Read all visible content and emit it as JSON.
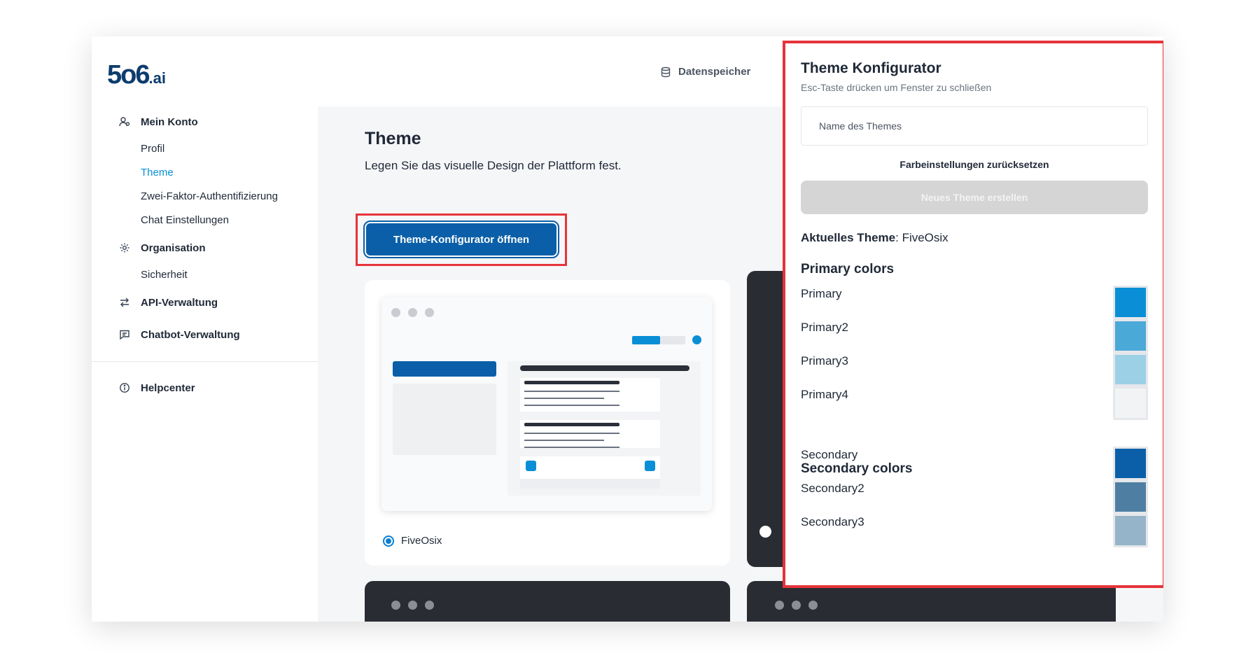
{
  "brand": {
    "logo_main": "5o6",
    "logo_suffix": ".ai"
  },
  "header": {
    "datastore_label": "Datenspeicher"
  },
  "sidebar": {
    "sections": [
      {
        "label": "Mein Konto",
        "icon": "user-settings-icon",
        "items": [
          "Profil",
          "Theme",
          "Zwei-Faktor-Authentifizierung",
          "Chat Einstellungen"
        ]
      },
      {
        "label": "Organisation",
        "icon": "gear-icon",
        "items": [
          "Sicherheit"
        ]
      },
      {
        "label": "API-Verwaltung",
        "icon": "arrows-exchange-icon",
        "items": []
      },
      {
        "label": "Chatbot-Verwaltung",
        "icon": "chat-icon",
        "items": []
      }
    ],
    "help_label": "Helpcenter",
    "active_item": "Theme"
  },
  "main": {
    "title": "Theme",
    "subtitle": "Legen Sie das visuelle Design der Plattform fest.",
    "open_configurator_button": "Theme-Konfigurator öffnen",
    "theme_cards": [
      {
        "name": "FiveOsix",
        "selected": true,
        "style": "light"
      }
    ]
  },
  "panel": {
    "title": "Theme Konfigurator",
    "hint": "Esc-Taste drücken um Fenster zu schließen",
    "name_placeholder": "Name des Themes",
    "reset_label": "Farbeinstellungen zurücksetzen",
    "new_theme_button": "Neues Theme erstellen",
    "current_theme_label": "Aktuelles Theme",
    "current_theme_value": "FiveOsix",
    "primary_heading": "Primary colors",
    "primary": [
      {
        "label": "Primary",
        "color": "#0a8fd6"
      },
      {
        "label": "Primary2",
        "color": "#4aa9d6"
      },
      {
        "label": "Primary3",
        "color": "#9bd0e6"
      },
      {
        "label": "Primary4",
        "color": "#f2f3f4"
      }
    ],
    "secondary_heading": "Secondary colors",
    "secondary": [
      {
        "label": "Secondary",
        "color": "#0b5fa8"
      },
      {
        "label": "Secondary2",
        "color": "#4e7fa3"
      },
      {
        "label": "Secondary3",
        "color": "#96b4c9"
      }
    ]
  },
  "colors": {
    "accent": "#0a8fd6",
    "button": "#0b5fa8",
    "highlight": "#e5343a",
    "dark_card": "#2a2c33"
  }
}
